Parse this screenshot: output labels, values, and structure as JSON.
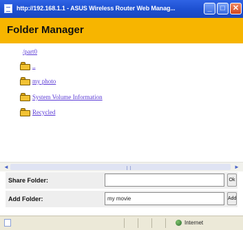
{
  "window": {
    "title": "http://192.168.1.1 - ASUS Wireless Router Web Manag..."
  },
  "page": {
    "heading": "Folder Manager",
    "current_path": "/part0"
  },
  "folders": [
    {
      "label": ".."
    },
    {
      "label": "my photo"
    },
    {
      "label": "System Volume Information"
    },
    {
      "label": "Recycled"
    }
  ],
  "form": {
    "share_folder": {
      "label": "Share Folder:",
      "value": "",
      "button": "Ok"
    },
    "add_folder": {
      "label": "Add Folder:",
      "value": "my movie",
      "button": "Add"
    }
  },
  "statusbar": {
    "zone": "Internet"
  },
  "icons": {
    "app": "ie-page-icon",
    "folder": "folder-icon",
    "minimize": "minimize-icon",
    "maximize": "maximize-icon",
    "close": "close-icon",
    "zone": "globe-icon"
  },
  "colors": {
    "titlebar": "#1d4fd0",
    "header_band": "#f7b500",
    "link": "#5b3ad6",
    "form_row": "#eeeeee",
    "statusbar": "#ece9d8"
  }
}
